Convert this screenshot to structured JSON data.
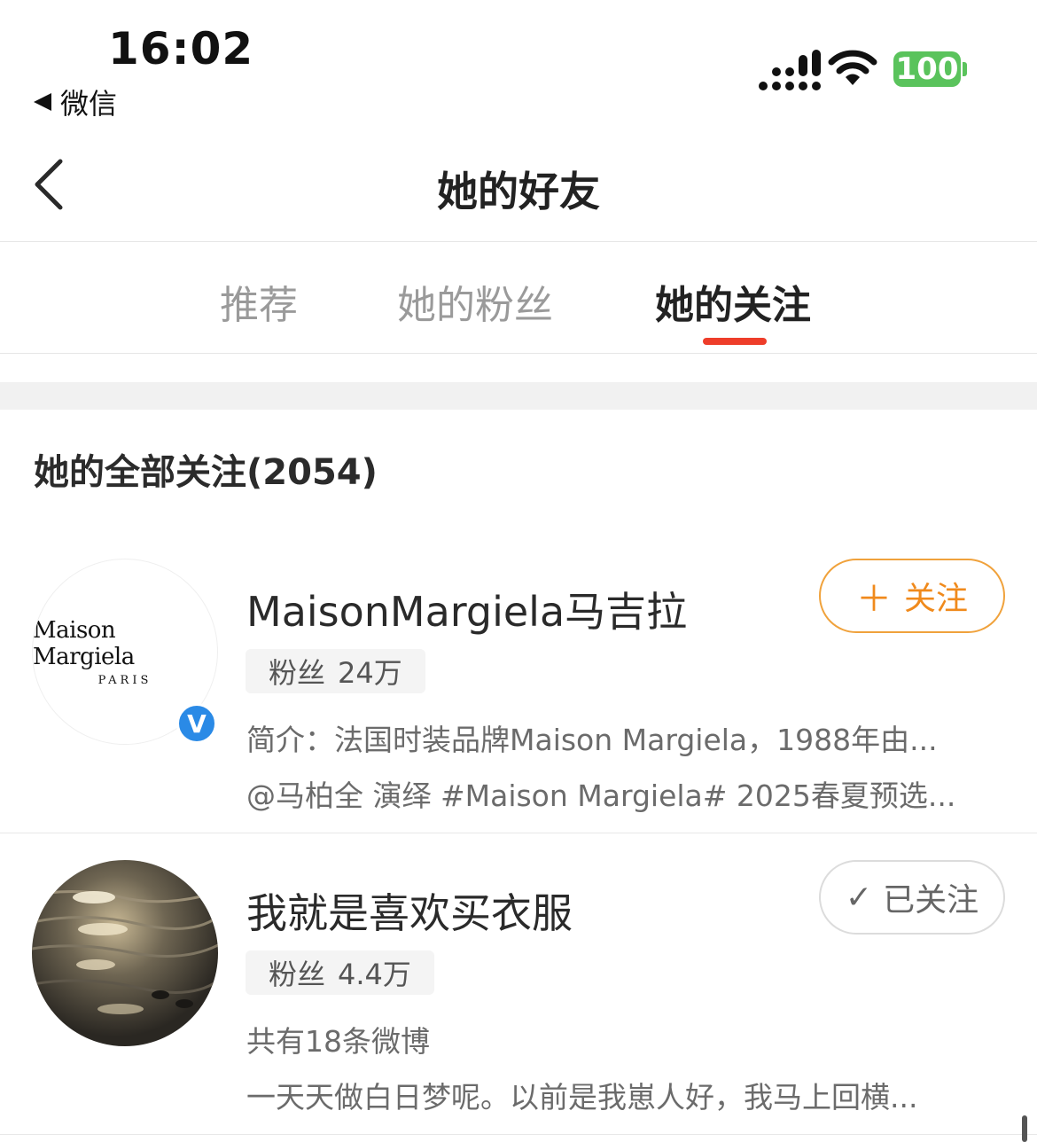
{
  "status_bar": {
    "time": "16:02",
    "back_app": "微信",
    "battery": "100",
    "battery_color": "#5ac35c"
  },
  "header": {
    "title": "她的好友",
    "back_icon": "chevron-left-icon"
  },
  "tabs": [
    {
      "label": "推荐",
      "active": false
    },
    {
      "label": "她的粉丝",
      "active": false
    },
    {
      "label": "她的关注",
      "active": true
    }
  ],
  "accent_color": "#ee3d2a",
  "section": {
    "title": "她的全部关注(2054)"
  },
  "users": [
    {
      "name": "MaisonMargiela马吉拉",
      "avatar_text": "Maison Margiela",
      "avatar_subtext": "PARIS",
      "verified": true,
      "verified_mark": "V",
      "fans_label": "粉丝",
      "fans_count": "24万",
      "line1": "简介：法国时装品牌Maison Margiela，1988年由...",
      "line2": "@马柏全 演绎 #Maison Margiela# 2025春夏预选...",
      "button": {
        "icon": "plus-icon",
        "icon_glyph": "＋",
        "label": "关注",
        "state": "follow"
      }
    },
    {
      "name": "我就是喜欢买衣服",
      "verified": false,
      "fans_label": "粉丝",
      "fans_count": "4.4万",
      "line1": "共有18条微博",
      "line2": "一天天做白日梦呢。以前是我崽人好，我马上回横...",
      "button": {
        "icon": "check-icon",
        "icon_glyph": "✓",
        "label": "已关注",
        "state": "followed"
      }
    }
  ]
}
